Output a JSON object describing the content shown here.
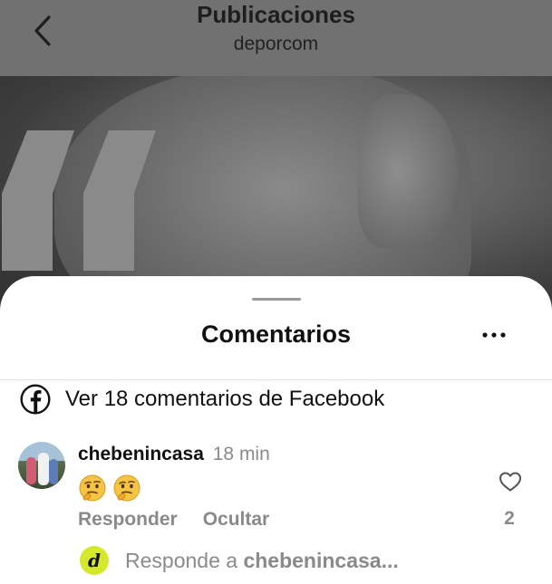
{
  "header": {
    "title": "Publicaciones",
    "subtitle": "deporcom"
  },
  "sheet": {
    "title": "Comentarios",
    "facebook_link": "Ver 18 comentarios de Facebook"
  },
  "comment": {
    "user": "chebenincasa",
    "time": "18 min",
    "emojis": [
      "thinking-face-emoji",
      "thinking-face-emoji"
    ],
    "reply_label": "Responder",
    "hide_label": "Ocultar",
    "like_count": "2"
  },
  "reply_box": {
    "avatar_letter": "d",
    "placeholder_prefix": "Responde a",
    "placeholder_user": "chebenincasa..."
  },
  "colors": {
    "background_dim": "#717171",
    "sheet": "#ffffff",
    "muted_text": "#8a8a8a",
    "reply_avatar": "#d6e82d"
  },
  "icons": [
    "back-chevron-icon",
    "more-options-icon",
    "facebook-icon",
    "heart-icon"
  ]
}
